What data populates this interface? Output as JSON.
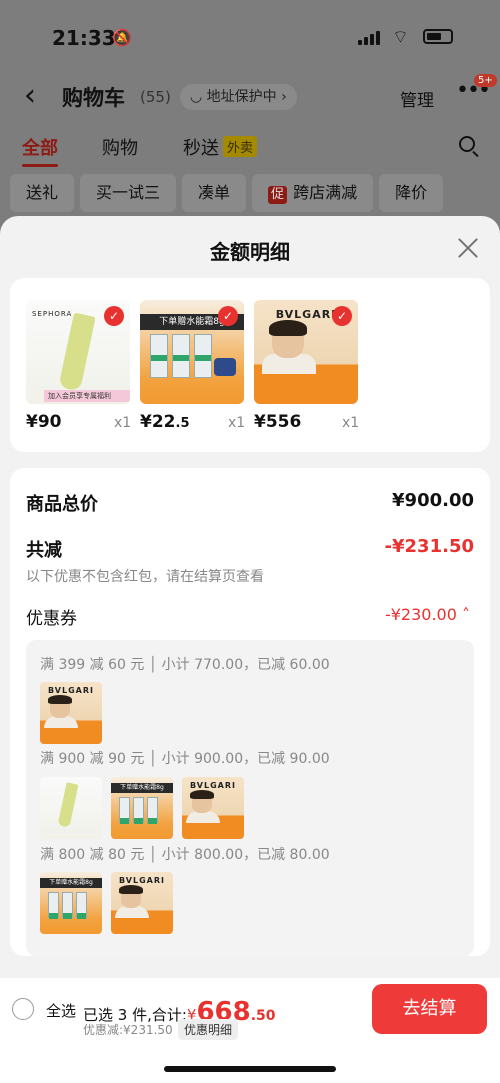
{
  "status_bar": {
    "time": "21:33"
  },
  "nav": {
    "back_icon": "chevron-left-icon",
    "title": "购物车",
    "count": "(55)",
    "address": "◡ 地址保护中 ›",
    "manage": "管理",
    "more": "•••",
    "more_badge": "5+"
  },
  "tabs": [
    {
      "label": "全部",
      "active": true
    },
    {
      "label": "购物"
    },
    {
      "label": "秒送",
      "tag": "外卖"
    }
  ],
  "chips": [
    {
      "label": "送礼"
    },
    {
      "label": "买一试三"
    },
    {
      "label": "凑单"
    },
    {
      "label": "跨店满减",
      "badge": "促"
    },
    {
      "label": "降价"
    }
  ],
  "sheet": {
    "title": "金额明细",
    "products": [
      {
        "price": "¥90",
        "qty": "x1",
        "brand": "SEPHORA",
        "band": "加入会员享专属福利"
      },
      {
        "price_main": "¥22",
        "price_dec": ".5",
        "qty": "x1",
        "head": "下单赠水能霜8g"
      },
      {
        "price": "¥556",
        "qty": "x1",
        "logo": "BVLGARI"
      }
    ],
    "total_label": "商品总价",
    "total_value": "¥900.00",
    "reduce_label": "共减",
    "reduce_value": "-¥231.50",
    "note": "以下优惠不包含红包，请在结算页查看",
    "coupon_label": "优惠券",
    "coupon_value": "-¥230.00 ˄",
    "rules": [
      "满 399 减 60 元 │ 小计 770.00，已减 60.00",
      "满 900 减 90 元 │ 小计 900.00，已减 90.00",
      "满 800 减 80 元 │ 小计 800.00，已减 80.00"
    ]
  },
  "bottom": {
    "select_all": "全选",
    "selected_text": "已选 3 件,合计:",
    "yen": "¥",
    "total_int": "668",
    "total_dec": ".50",
    "discount": "优惠减:¥231.50",
    "detail": "优惠明细",
    "checkout": "去结算"
  },
  "colors": {
    "accent": "#e8322f",
    "checkout": "#ef3a3a"
  }
}
